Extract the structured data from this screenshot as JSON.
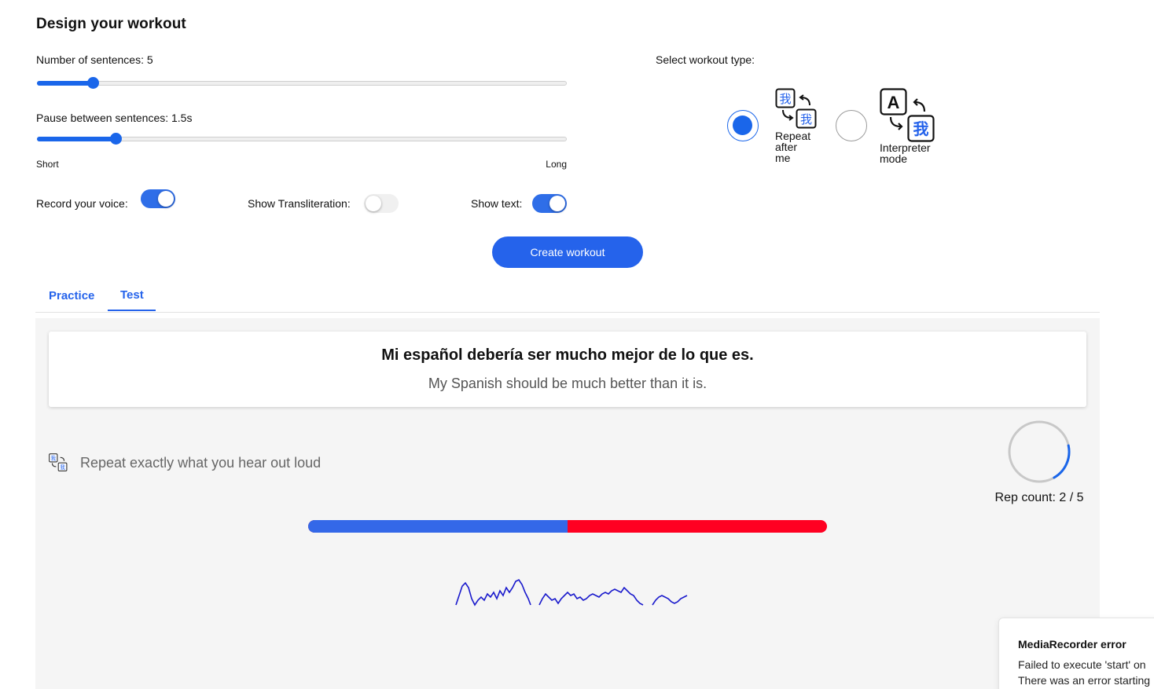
{
  "header": {
    "title": "Design your workout"
  },
  "settings": {
    "sentences": {
      "label": "Number of sentences: 5",
      "value": 5,
      "fraction": 0.105
    },
    "pause": {
      "label": "Pause between sentences: 1.5s",
      "value": 1.5,
      "fraction": 0.148,
      "min_label": "Short",
      "max_label": "Long"
    },
    "record_voice": {
      "label": "Record your voice:",
      "on": true
    },
    "transliteration": {
      "label": "Show Transliteration:",
      "on": false
    },
    "show_text": {
      "label": "Show text:",
      "on": true
    }
  },
  "workout_type": {
    "label": "Select workout type:",
    "options": [
      {
        "label_lines": [
          "Repeat",
          "after",
          "me"
        ],
        "selected": true,
        "icon": "repeat-after-me-icon"
      },
      {
        "label_lines": [
          "Interpreter",
          "mode"
        ],
        "selected": false,
        "icon": "interpreter-mode-icon"
      }
    ]
  },
  "create_button": {
    "label": "Create workout"
  },
  "tabs": [
    {
      "label": "Practice",
      "active": false
    },
    {
      "label": "Test",
      "active": true
    }
  ],
  "sentence_card": {
    "target": "Mi español debería ser mucho mejor de lo que es.",
    "native": "My Spanish should be much better than it is."
  },
  "instruction": {
    "text": "Repeat exactly what you hear out loud",
    "icon": "repeat-after-me-icon"
  },
  "rep_counter": {
    "label": "Rep count: 2 / 5",
    "current": 2,
    "total": 5,
    "ring_fraction": 0.2
  },
  "progress_bar": {
    "fraction": 0.5,
    "done_color": "#3468e8",
    "remaining_color": "#ff0022"
  },
  "toast": {
    "title": "MediaRecorder error",
    "line1": "Failed to execute 'start' on",
    "line2": "There was an error starting"
  },
  "colors": {
    "accent": "#2563eb",
    "waveform": "#1a1acc"
  }
}
